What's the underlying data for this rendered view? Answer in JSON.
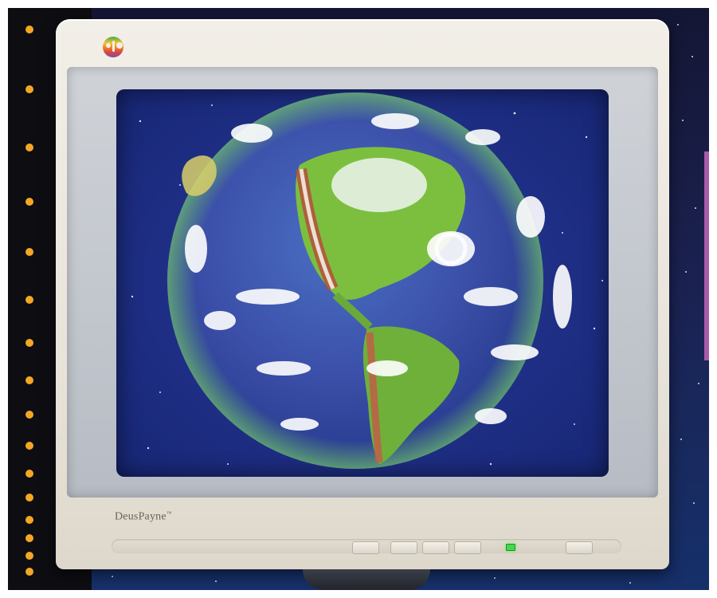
{
  "monitor": {
    "brand_label": "DeusPayne",
    "brand_mark": "™",
    "logo_icon": "rainbow-logo-icon",
    "screen_content": "earth-globe-icon",
    "power_led_color": "#43d84a"
  },
  "colors": {
    "sidebar_dots": "#f5a623",
    "accent_bar": "#a85ba8",
    "space_background": "#1b2150"
  }
}
